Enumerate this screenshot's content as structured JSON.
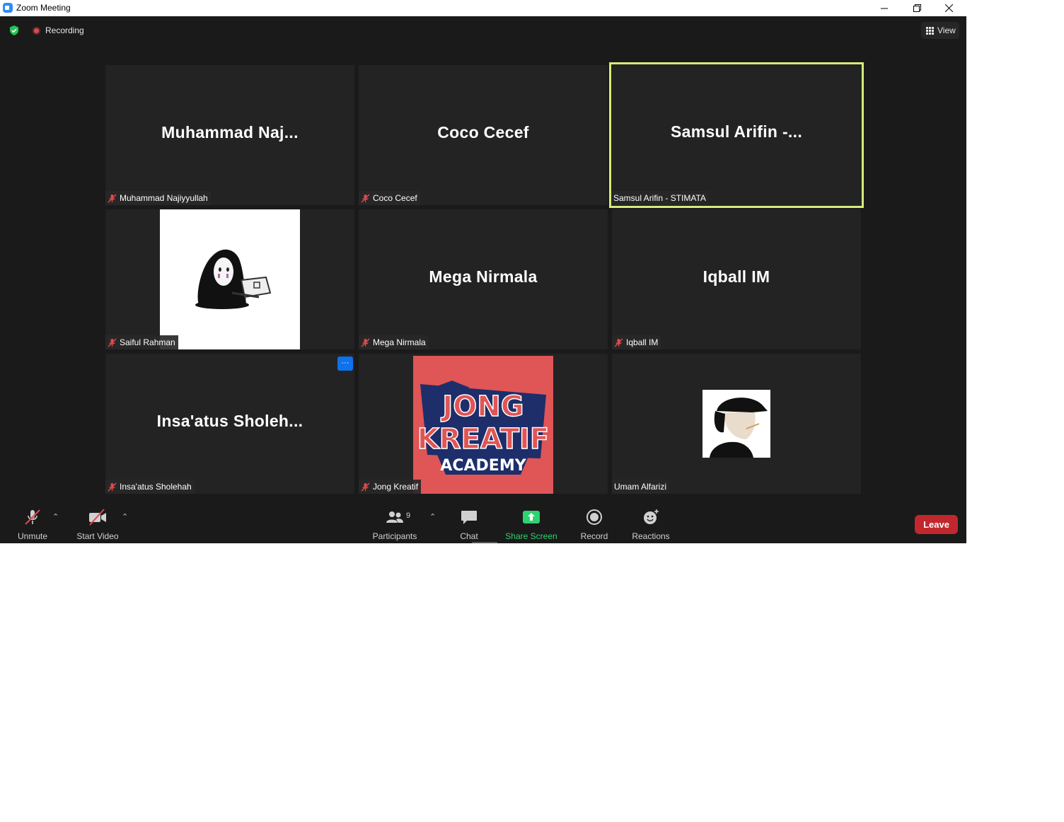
{
  "window": {
    "title": "Zoom Meeting"
  },
  "topbar": {
    "recording_label": "Recording",
    "view_label": "View"
  },
  "tiles": [
    {
      "big_name": "Muhammad  Naj...",
      "label": "Muhammad Najiyyullah",
      "muted": true
    },
    {
      "big_name": "Coco Cecef",
      "label": "Coco Cecef",
      "muted": true
    },
    {
      "big_name": "Samsul  Arifin  -...",
      "label": "Samsul Arifin - STIMATA",
      "muted": false,
      "active_speaker": true
    },
    {
      "big_name": "",
      "label": "Saiful Rahman",
      "muted": true,
      "avatar": "hooded-figure-laptop"
    },
    {
      "big_name": "Mega Nirmala",
      "label": "Mega Nirmala",
      "muted": true
    },
    {
      "big_name": "Iqball IM",
      "label": "Iqball IM",
      "muted": true
    },
    {
      "big_name": "Insa'atus  Sholeh...",
      "label": "Insa'atus Sholehah",
      "muted": true,
      "more_menu": "···"
    },
    {
      "big_name": "",
      "label": "Jong Kreatif",
      "muted": true,
      "avatar_text": [
        "JONG",
        "KREATIF",
        "ACADEMY"
      ]
    },
    {
      "big_name": "",
      "label": "Umam Alfarizi",
      "muted": false,
      "avatar": "anime-character-cap"
    }
  ],
  "toolbar": {
    "unmute": "Unmute",
    "start_video": "Start Video",
    "participants": "Participants",
    "participants_count": "9",
    "chat": "Chat",
    "share_screen": "Share Screen",
    "record": "Record",
    "reactions": "Reactions",
    "leave": "Leave"
  },
  "colors": {
    "background": "#1a1a1a",
    "tile": "#232323",
    "active_speaker_border": "#d4ec7a",
    "share_green": "#2dd36f",
    "leave_red": "#c1272d",
    "mute_red": "#e04a4a",
    "more_blue": "#0e72ed"
  }
}
